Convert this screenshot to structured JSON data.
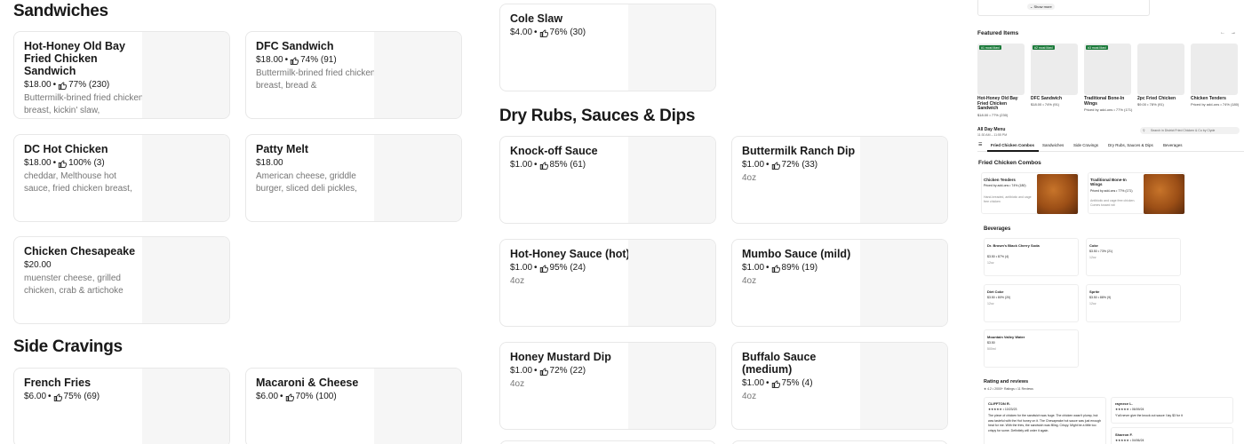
{
  "sections": {
    "sandwiches": "Sandwiches",
    "side_cravings": "Side Cravings",
    "dry_rubs": "Dry Rubs, Sauces & Dips"
  },
  "cards": {
    "hot_honey_old_bay": {
      "name": "Hot-Honey Old Bay Fried Chicken Sandwich",
      "price": "$18.00",
      "rating": "77% (230)",
      "desc": "Buttermilk-brined fried chicken breast, kickin' slaw,"
    },
    "dfc_sandwich": {
      "name": "DFC Sandwich",
      "price": "$18.00",
      "rating": "74% (91)",
      "desc": "Buttermilk-brined fried chicken breast, bread &"
    },
    "dc_hot_chicken": {
      "name": "DC Hot Chicken",
      "price": "$18.00",
      "rating": "100% (3)",
      "desc": "cheddar, Melthouse hot sauce, fried chicken breast,"
    },
    "patty_melt": {
      "name": "Patty Melt",
      "price": "$18.00",
      "rating": "",
      "desc": "American cheese, griddle burger, sliced deli pickles,"
    },
    "chicken_chesapeake": {
      "name": "Chicken Chesapeake",
      "price": "$20.00",
      "rating": "",
      "desc": "muenster cheese, grilled chicken, crab & artichoke"
    },
    "french_fries": {
      "name": "French Fries",
      "price": "$6.00",
      "rating": "75% (69)",
      "desc": ""
    },
    "mac_cheese": {
      "name": "Macaroni & Cheese",
      "price": "$6.00",
      "rating": "70% (100)",
      "desc": ""
    },
    "cole_slaw": {
      "name": "Cole Slaw",
      "price": "$4.00",
      "rating": "76% (30)",
      "desc": ""
    },
    "knock_off": {
      "name": "Knock-off Sauce",
      "price": "$1.00",
      "rating": "85% (61)",
      "desc": ""
    },
    "buttermilk_ranch": {
      "name": "Buttermilk Ranch Dip",
      "price": "$1.00",
      "rating": "72% (33)",
      "desc": "4oz"
    },
    "hot_honey_sauce": {
      "name": "Hot-Honey Sauce (hot)",
      "price": "$1.00",
      "rating": "95% (24)",
      "desc": "4oz"
    },
    "mumbo": {
      "name": "Mumbo Sauce (mild)",
      "price": "$1.00",
      "rating": "89% (19)",
      "desc": "4oz"
    },
    "honey_mustard": {
      "name": "Honey Mustard Dip",
      "price": "$1.00",
      "rating": "72% (22)",
      "desc": "4oz"
    },
    "buffalo": {
      "name": "Buffalo Sauce (medium)",
      "price": "$1.00",
      "rating": "75% (4)",
      "desc": "4oz"
    }
  },
  "side_panel": {
    "show_more": "Show more",
    "featured_title": "Featured Items",
    "featured": [
      {
        "badge": "#1 most liked",
        "name": "Hot-Honey Old Bay Fried Chicken Sandwich",
        "meta": "$18.00 • 77% (230)"
      },
      {
        "badge": "#2 most liked",
        "name": "DFC Sandwich",
        "meta": "$18.00 • 74% (91)"
      },
      {
        "badge": "#3 most liked",
        "name": "Traditional Bone-In Wings",
        "meta": "Priced by add-ons • 77% (171)"
      },
      {
        "badge": "",
        "name": "2pc Fried Chicken",
        "meta": "$9.00 • 78% (91)"
      },
      {
        "badge": "",
        "name": "Chicken Tenders",
        "meta": "Priced by add-ons • 74% (180)"
      }
    ],
    "menu_title": "All Day Menu",
    "menu_hours": "11:30 AM – 11:55 PM",
    "search_placeholder": "Search in District Fried Chicken & Co by Clyde",
    "tabs": [
      "Fried Chicken Combos",
      "Sandwiches",
      "Side Cravings",
      "Dry Rubs, Sauces & Dips",
      "Beverages"
    ],
    "combos_title": "Fried Chicken Combos",
    "combos": [
      {
        "name": "Chicken Tenders",
        "meta": "Priced by add-ons • 74% (180)",
        "desc": "Hand-breaded, antibiotic and cage free chicken"
      },
      {
        "name": "Traditional Bone-In Wings",
        "meta": "Priced by add-ons • 77% (171)",
        "desc": "Antibiotic and cage free chicken. Comes tossed wit"
      }
    ],
    "beverages_title": "Beverages",
    "beverages": [
      {
        "name": "Dr. Brown's Black Cherry Soda",
        "meta": "$3.50 • 87% (4)",
        "size": "12oz"
      },
      {
        "name": "Coke",
        "meta": "$3.50 • 73% (21)",
        "size": "12oz"
      },
      {
        "name": "Diet Coke",
        "meta": "$3.50 • 80% (20)",
        "size": "12oz"
      },
      {
        "name": "Sprite",
        "meta": "$3.50 • 88% (9)",
        "size": "12oz"
      },
      {
        "name": "Mountain Valley Water",
        "meta": "$3.50",
        "size": "500ml"
      }
    ],
    "ratings_title": "Rating and reviews",
    "ratings_meta": "★ 4.2 • 2000+ Ratings • 11 Reviews",
    "reviews": [
      {
        "author": "CLIFFTON R.",
        "date": "★★★★★ • 10/23/23",
        "text": "The piece of chicken for the sandwich was huge. The chicken wasn't plump, but was tasteful with the Hot honey on it. The Chesapeake hot sauce was just enough heat for me. With the fries, the sandwich was filling. Crispy. Might be a little too crispy for some. Definitely will order it again."
      },
      {
        "author": "raynece L.",
        "date": "★★★★★ • 06/09/24",
        "text": "Y'all never give the knock out sauce I lay $3 for it"
      },
      {
        "author": "Sharron F.",
        "date": "★★★★★ • 04/06/24",
        "text": ""
      }
    ]
  },
  "colors": {
    "badge_green": "#1b7a3a",
    "text": "#191919",
    "muted": "#767676",
    "thumb_bg": "#f6f6f6"
  }
}
